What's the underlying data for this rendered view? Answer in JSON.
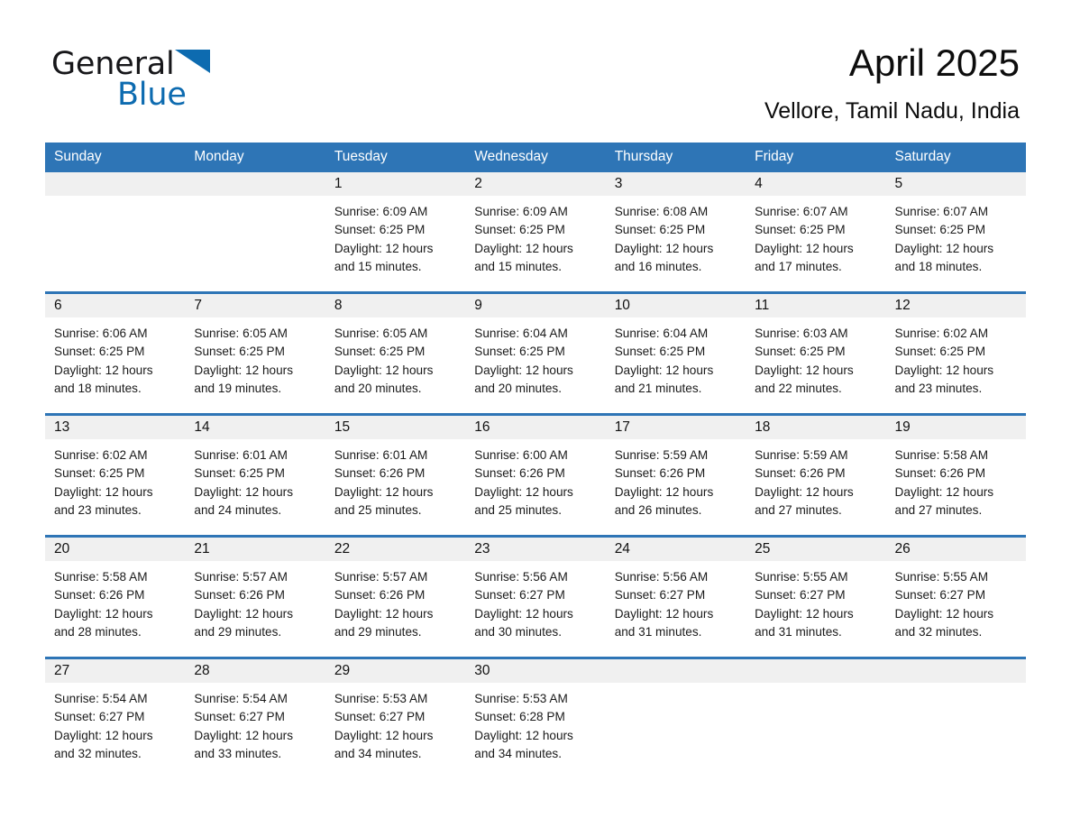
{
  "brand": {
    "name_part1": "General",
    "name_part2": "Blue",
    "logo_icon": "triangle-flag-icon",
    "accent_color": "#0d6bb0"
  },
  "header": {
    "title": "April 2025",
    "subtitle": "Vellore, Tamil Nadu, India"
  },
  "colors": {
    "header_blue": "#2e75b6",
    "daynum_band": "#f0f0f0",
    "text": "#1a1a1a"
  },
  "calendar": {
    "weekday_headers": [
      "Sunday",
      "Monday",
      "Tuesday",
      "Wednesday",
      "Thursday",
      "Friday",
      "Saturday"
    ],
    "weeks": [
      [
        {
          "day": "",
          "lines": []
        },
        {
          "day": "",
          "lines": []
        },
        {
          "day": "1",
          "lines": [
            "Sunrise: 6:09 AM",
            "Sunset: 6:25 PM",
            "Daylight: 12 hours",
            "and 15 minutes."
          ]
        },
        {
          "day": "2",
          "lines": [
            "Sunrise: 6:09 AM",
            "Sunset: 6:25 PM",
            "Daylight: 12 hours",
            "and 15 minutes."
          ]
        },
        {
          "day": "3",
          "lines": [
            "Sunrise: 6:08 AM",
            "Sunset: 6:25 PM",
            "Daylight: 12 hours",
            "and 16 minutes."
          ]
        },
        {
          "day": "4",
          "lines": [
            "Sunrise: 6:07 AM",
            "Sunset: 6:25 PM",
            "Daylight: 12 hours",
            "and 17 minutes."
          ]
        },
        {
          "day": "5",
          "lines": [
            "Sunrise: 6:07 AM",
            "Sunset: 6:25 PM",
            "Daylight: 12 hours",
            "and 18 minutes."
          ]
        }
      ],
      [
        {
          "day": "6",
          "lines": [
            "Sunrise: 6:06 AM",
            "Sunset: 6:25 PM",
            "Daylight: 12 hours",
            "and 18 minutes."
          ]
        },
        {
          "day": "7",
          "lines": [
            "Sunrise: 6:05 AM",
            "Sunset: 6:25 PM",
            "Daylight: 12 hours",
            "and 19 minutes."
          ]
        },
        {
          "day": "8",
          "lines": [
            "Sunrise: 6:05 AM",
            "Sunset: 6:25 PM",
            "Daylight: 12 hours",
            "and 20 minutes."
          ]
        },
        {
          "day": "9",
          "lines": [
            "Sunrise: 6:04 AM",
            "Sunset: 6:25 PM",
            "Daylight: 12 hours",
            "and 20 minutes."
          ]
        },
        {
          "day": "10",
          "lines": [
            "Sunrise: 6:04 AM",
            "Sunset: 6:25 PM",
            "Daylight: 12 hours",
            "and 21 minutes."
          ]
        },
        {
          "day": "11",
          "lines": [
            "Sunrise: 6:03 AM",
            "Sunset: 6:25 PM",
            "Daylight: 12 hours",
            "and 22 minutes."
          ]
        },
        {
          "day": "12",
          "lines": [
            "Sunrise: 6:02 AM",
            "Sunset: 6:25 PM",
            "Daylight: 12 hours",
            "and 23 minutes."
          ]
        }
      ],
      [
        {
          "day": "13",
          "lines": [
            "Sunrise: 6:02 AM",
            "Sunset: 6:25 PM",
            "Daylight: 12 hours",
            "and 23 minutes."
          ]
        },
        {
          "day": "14",
          "lines": [
            "Sunrise: 6:01 AM",
            "Sunset: 6:25 PM",
            "Daylight: 12 hours",
            "and 24 minutes."
          ]
        },
        {
          "day": "15",
          "lines": [
            "Sunrise: 6:01 AM",
            "Sunset: 6:26 PM",
            "Daylight: 12 hours",
            "and 25 minutes."
          ]
        },
        {
          "day": "16",
          "lines": [
            "Sunrise: 6:00 AM",
            "Sunset: 6:26 PM",
            "Daylight: 12 hours",
            "and 25 minutes."
          ]
        },
        {
          "day": "17",
          "lines": [
            "Sunrise: 5:59 AM",
            "Sunset: 6:26 PM",
            "Daylight: 12 hours",
            "and 26 minutes."
          ]
        },
        {
          "day": "18",
          "lines": [
            "Sunrise: 5:59 AM",
            "Sunset: 6:26 PM",
            "Daylight: 12 hours",
            "and 27 minutes."
          ]
        },
        {
          "day": "19",
          "lines": [
            "Sunrise: 5:58 AM",
            "Sunset: 6:26 PM",
            "Daylight: 12 hours",
            "and 27 minutes."
          ]
        }
      ],
      [
        {
          "day": "20",
          "lines": [
            "Sunrise: 5:58 AM",
            "Sunset: 6:26 PM",
            "Daylight: 12 hours",
            "and 28 minutes."
          ]
        },
        {
          "day": "21",
          "lines": [
            "Sunrise: 5:57 AM",
            "Sunset: 6:26 PM",
            "Daylight: 12 hours",
            "and 29 minutes."
          ]
        },
        {
          "day": "22",
          "lines": [
            "Sunrise: 5:57 AM",
            "Sunset: 6:26 PM",
            "Daylight: 12 hours",
            "and 29 minutes."
          ]
        },
        {
          "day": "23",
          "lines": [
            "Sunrise: 5:56 AM",
            "Sunset: 6:27 PM",
            "Daylight: 12 hours",
            "and 30 minutes."
          ]
        },
        {
          "day": "24",
          "lines": [
            "Sunrise: 5:56 AM",
            "Sunset: 6:27 PM",
            "Daylight: 12 hours",
            "and 31 minutes."
          ]
        },
        {
          "day": "25",
          "lines": [
            "Sunrise: 5:55 AM",
            "Sunset: 6:27 PM",
            "Daylight: 12 hours",
            "and 31 minutes."
          ]
        },
        {
          "day": "26",
          "lines": [
            "Sunrise: 5:55 AM",
            "Sunset: 6:27 PM",
            "Daylight: 12 hours",
            "and 32 minutes."
          ]
        }
      ],
      [
        {
          "day": "27",
          "lines": [
            "Sunrise: 5:54 AM",
            "Sunset: 6:27 PM",
            "Daylight: 12 hours",
            "and 32 minutes."
          ]
        },
        {
          "day": "28",
          "lines": [
            "Sunrise: 5:54 AM",
            "Sunset: 6:27 PM",
            "Daylight: 12 hours",
            "and 33 minutes."
          ]
        },
        {
          "day": "29",
          "lines": [
            "Sunrise: 5:53 AM",
            "Sunset: 6:27 PM",
            "Daylight: 12 hours",
            "and 34 minutes."
          ]
        },
        {
          "day": "30",
          "lines": [
            "Sunrise: 5:53 AM",
            "Sunset: 6:28 PM",
            "Daylight: 12 hours",
            "and 34 minutes."
          ]
        },
        {
          "day": "",
          "lines": []
        },
        {
          "day": "",
          "lines": []
        },
        {
          "day": "",
          "lines": []
        }
      ]
    ]
  }
}
